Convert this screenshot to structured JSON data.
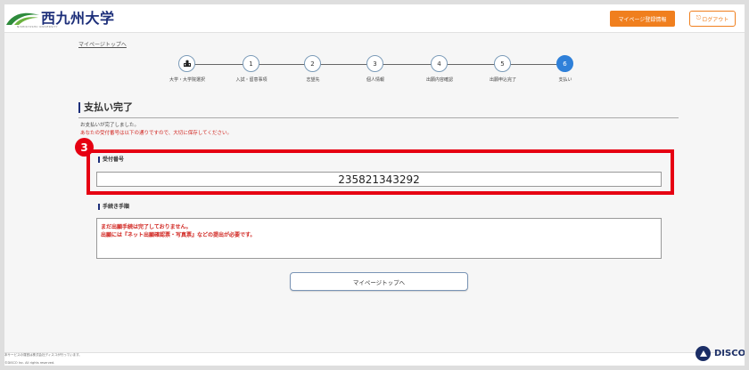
{
  "header": {
    "university_name": "西九州大学",
    "logo_subtext": "NISHIKYUSHU UNIVERSITY",
    "register_button": "マイページ登録情報",
    "logout_button": "ログアウト"
  },
  "nav": {
    "top_link": "マイページトップへ"
  },
  "stepper": {
    "steps": [
      {
        "number": "",
        "label": "大学・大学院選択",
        "icon": "school-icon"
      },
      {
        "number": "1",
        "label": "入試・留意事項"
      },
      {
        "number": "2",
        "label": "志望先"
      },
      {
        "number": "3",
        "label": "個人情報"
      },
      {
        "number": "4",
        "label": "出願内容確認"
      },
      {
        "number": "5",
        "label": "出願申込完了"
      },
      {
        "number": "6",
        "label": "支払い"
      }
    ],
    "active_step": 6
  },
  "main": {
    "title": "支払い完了",
    "message_1": "お支払いが完了しました。",
    "message_2": "あなたの受付番号は以下の通りですので、大切に保存してください。",
    "badge_number": "3",
    "receipt_label": "受付番号",
    "receipt_number": "235821343292",
    "procedure_label": "手続き手順",
    "procedure_lines": [
      "まだ出願手続は完了しておりません。",
      "出願には『ネット出願確認票・写真票』などの提出が必要です。"
    ],
    "top_button": "マイページトップへ"
  },
  "footer": {
    "line_1": "本サービスの運営は株式会社ディスコが行っています。",
    "line_2": "©DISCO Inc. All rights reserved.",
    "brand": "DISCO"
  },
  "colors": {
    "accent_orange": "#f07f1e",
    "active_step_blue": "#2f80d9",
    "highlight_red": "#e60012",
    "brand_navy": "#1d2f7a"
  }
}
